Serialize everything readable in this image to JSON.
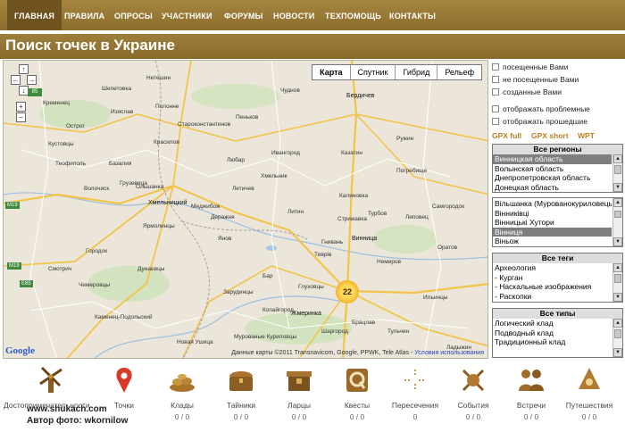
{
  "nav": {
    "items": [
      {
        "label": "ГЛАВНАЯ",
        "active": true
      },
      {
        "label": "ПРАВИЛА"
      },
      {
        "label": "ОПРОСЫ"
      },
      {
        "label": "УЧАСТНИКИ"
      },
      {
        "label": "ФОРУМЫ"
      },
      {
        "label": "НОВОСТИ"
      },
      {
        "label": "ТЕХПОМОЩЬ"
      },
      {
        "label": "КОНТАКТЫ"
      }
    ]
  },
  "page": {
    "title": "Поиск точек в Украине"
  },
  "map": {
    "types": [
      "Карта",
      "Спутник",
      "Гибрид",
      "Рельеф"
    ],
    "selected_type": "Карта",
    "zoom_level": "85",
    "cluster_count": "22",
    "copyright": "Данные карты ©2011 Transnavicom, Google, PPWK, Tele Atlas - ",
    "terms_link": "Условия использования",
    "google_logo": "Google",
    "road_signs": [
      "M19",
      "E85",
      "M19"
    ],
    "cities": [
      "Бердичев",
      "Жмеринка",
      "Винница",
      "Хмельницкий",
      "Каменец-Подольский",
      "Староконстантинов",
      "Казатин",
      "Калиновка",
      "Гнивань",
      "Стрижавка",
      "Тиврів",
      "Немиров",
      "Липовец",
      "Турбов",
      "Шепетовка",
      "Полонне",
      "Красилов",
      "Изяслав",
      "Летичев",
      "Деражня",
      "Ярмолинцы",
      "Городок",
      "Смотрич",
      "Дунаевцы",
      "Новая Ушица",
      "Бар",
      "Литин",
      "Хмельник",
      "Янов",
      "Погребище",
      "Оратов",
      "Ильинцы",
      "Тульчин",
      "Брацлав",
      "Шаргород",
      "Мурованые Куриловцы",
      "Копайгород",
      "Чемеровцы",
      "Ольшанка",
      "Волочиск",
      "Теофиполь",
      "Базалия",
      "Меджибож",
      "Кустовцы",
      "Грузевица",
      "Нетешин",
      "Кременец",
      "Острог",
      "Пеньков",
      "Чуднов",
      "Любар",
      "Ружин",
      "Самгородок",
      "Глуховцы",
      "Зарудинцы",
      "Ивангород",
      "Ладыжин"
    ]
  },
  "sidebar": {
    "filters": [
      {
        "label": "посещенные Вами"
      },
      {
        "label": "не посещенные Вами"
      },
      {
        "label": "созданные Вами"
      },
      {
        "label": "отображать проблемные"
      },
      {
        "label": "отображать прошедшие"
      }
    ],
    "gpx_links": [
      "GPX full",
      "GPX short",
      "WPT"
    ],
    "regions": {
      "header": "Все регионы",
      "items": [
        "Винницкая область",
        "Волынская область",
        "Днепропетровская область",
        "Донецкая область"
      ],
      "selected": 0
    },
    "places": {
      "items": [
        "Вільшанка (Мурованокуриловецький)",
        "Вінниківці",
        "Вінницькі Хутори",
        "Вінниця",
        "Віньож"
      ],
      "selected": 3
    },
    "tags": {
      "header": "Все теги",
      "items": [
        "Археология",
        "- Курган",
        "- Наскальные изображения",
        "- Раскопки"
      ]
    },
    "types": {
      "header": "Все типы",
      "items": [
        "Логический клад",
        "Подводный клад",
        "Традиционный клад"
      ]
    }
  },
  "categories": [
    {
      "label": "Достопримечательности",
      "count": "",
      "icon": "windmill-icon"
    },
    {
      "label": "Точки",
      "count": "",
      "icon": "map-pin-icon"
    },
    {
      "label": "Клады",
      "count": "0 / 0",
      "icon": "treasure-coins-icon"
    },
    {
      "label": "Тайники",
      "count": "0 / 0",
      "icon": "chest-icon"
    },
    {
      "label": "Ларцы",
      "count": "0 / 0",
      "icon": "casket-icon"
    },
    {
      "label": "Квесты",
      "count": "0 / 0",
      "icon": "quest-icon"
    },
    {
      "label": "Пересечения",
      "count": "0",
      "icon": "crosshair-icon"
    },
    {
      "label": "События",
      "count": "0 / 0",
      "icon": "crossed-swords-icon"
    },
    {
      "label": "Встречи",
      "count": "0 / 0",
      "icon": "meeting-icon"
    },
    {
      "label": "Путешествия",
      "count": "0 / 0",
      "icon": "travel-icon"
    }
  ],
  "watermark": {
    "line1": "www.shukach.com",
    "line2": "Автор фото: wkornilow"
  },
  "colors": {
    "nav_bg": "#9a7b3a",
    "nav_active": "#6e5320",
    "gpx_link": "#b58122",
    "cluster": "#f3b427"
  }
}
